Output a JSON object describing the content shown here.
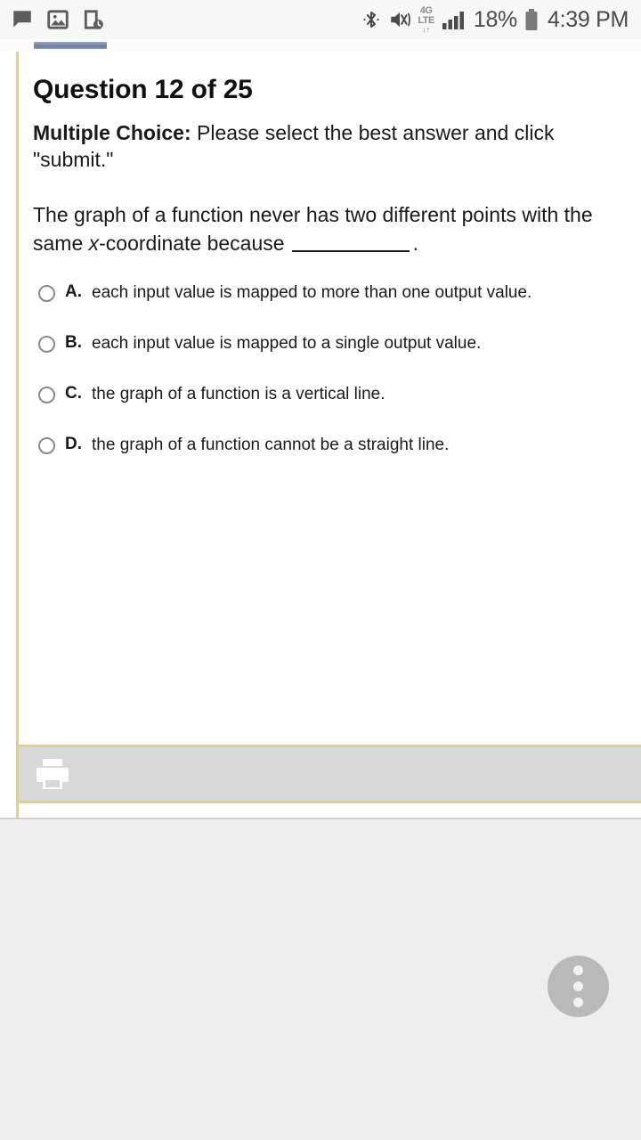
{
  "statusbar": {
    "left_icons": [
      {
        "name": "message-icon",
        "label": "message"
      },
      {
        "name": "image-icon",
        "label": "image"
      },
      {
        "name": "device-clock-icon",
        "label": "device-clock"
      }
    ],
    "bluetooth_icon": "bluetooth-icon",
    "mute_icon": "vibrate-mute-icon",
    "network": {
      "gen": "4G",
      "type": "LTE",
      "arrows": "↓↑"
    },
    "signal_icon": "signal-bars-icon",
    "battery_percent": "18%",
    "battery_icon": "battery-icon",
    "time": "4:39 PM"
  },
  "page": {
    "title": "Question 12 of 25",
    "instructions_bold": "Multiple Choice:",
    "instructions_rest": " Please select the best answer and click \"submit.\"",
    "stem_part1": "The graph of a function never has two different points with the same ",
    "stem_italic": "x",
    "stem_part2": "-coordinate because",
    "stem_end": ".",
    "options": [
      {
        "letter": "A.",
        "text": "each input value is mapped to more than one output value.",
        "selected": false
      },
      {
        "letter": "B.",
        "text": "each input value is mapped to a single output value.",
        "selected": false
      },
      {
        "letter": "C.",
        "text": "the graph of a function is a vertical line.",
        "selected": false
      },
      {
        "letter": "D.",
        "text": "the graph of a function cannot be a straight line.",
        "selected": false
      }
    ],
    "toolbar": {
      "print_icon": "print-icon"
    }
  },
  "lower": {
    "fab_icon": "overflow-menu-icon"
  },
  "colors": {
    "card_border": "#d9cfa0",
    "tab_indicator": "#6b7e9e",
    "toolbar_bg": "#d8d8d8",
    "lower_bg": "#eeeeee",
    "fab_bg": "#b9b9b9"
  }
}
